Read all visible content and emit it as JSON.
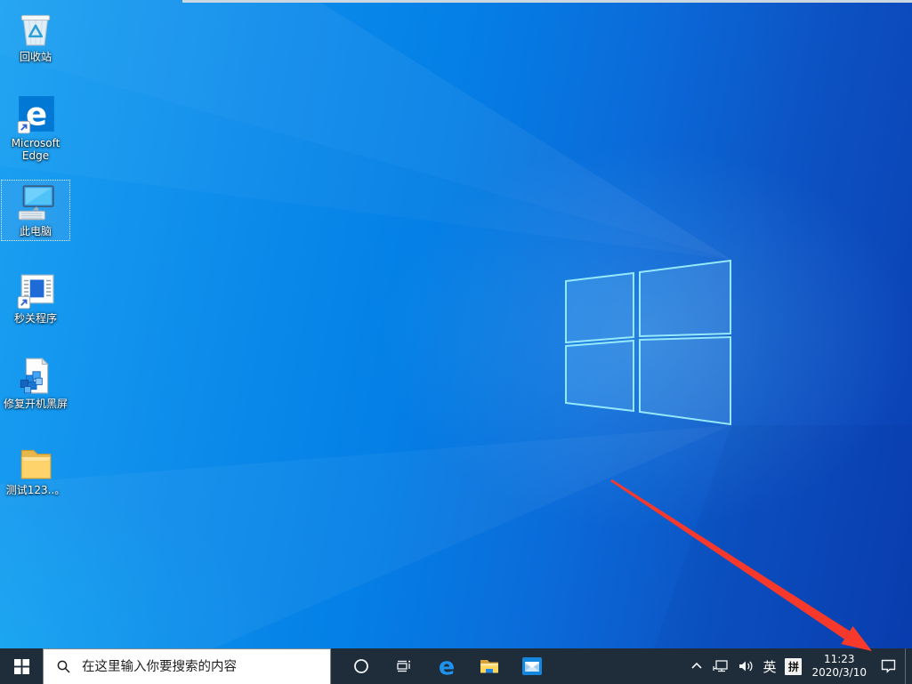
{
  "desktop": {
    "icons": [
      {
        "name": "recycle-bin",
        "label": "回收站",
        "selected": false
      },
      {
        "name": "microsoft-edge",
        "label": "Microsoft Edge",
        "selected": false
      },
      {
        "name": "this-pc",
        "label": "此电脑",
        "selected": true
      },
      {
        "name": "miaoguan-program",
        "label": "秒关程序",
        "selected": false
      },
      {
        "name": "fix-boot-black-screen",
        "label": "修复开机黑屏",
        "selected": false
      },
      {
        "name": "test-folder",
        "label": "测试123..。",
        "selected": false
      }
    ]
  },
  "taskbar": {
    "search": {
      "placeholder": "在这里输入你要搜索的内容"
    },
    "buttons": [
      "start",
      "search",
      "cortana",
      "task-view",
      "edge",
      "file-explorer",
      "mail"
    ],
    "tray": {
      "language": "英",
      "ime": "拼",
      "time": "11:23",
      "date": "2020/3/10"
    }
  },
  "annotation": {
    "shape": "arrow",
    "color": "#f7392b"
  },
  "colors": {
    "taskbar": "#1f2c3a",
    "wallpaper_light": "#1ba1f2",
    "wallpaper_dark": "#0a3fb2",
    "logo_border": "#9beefc"
  }
}
